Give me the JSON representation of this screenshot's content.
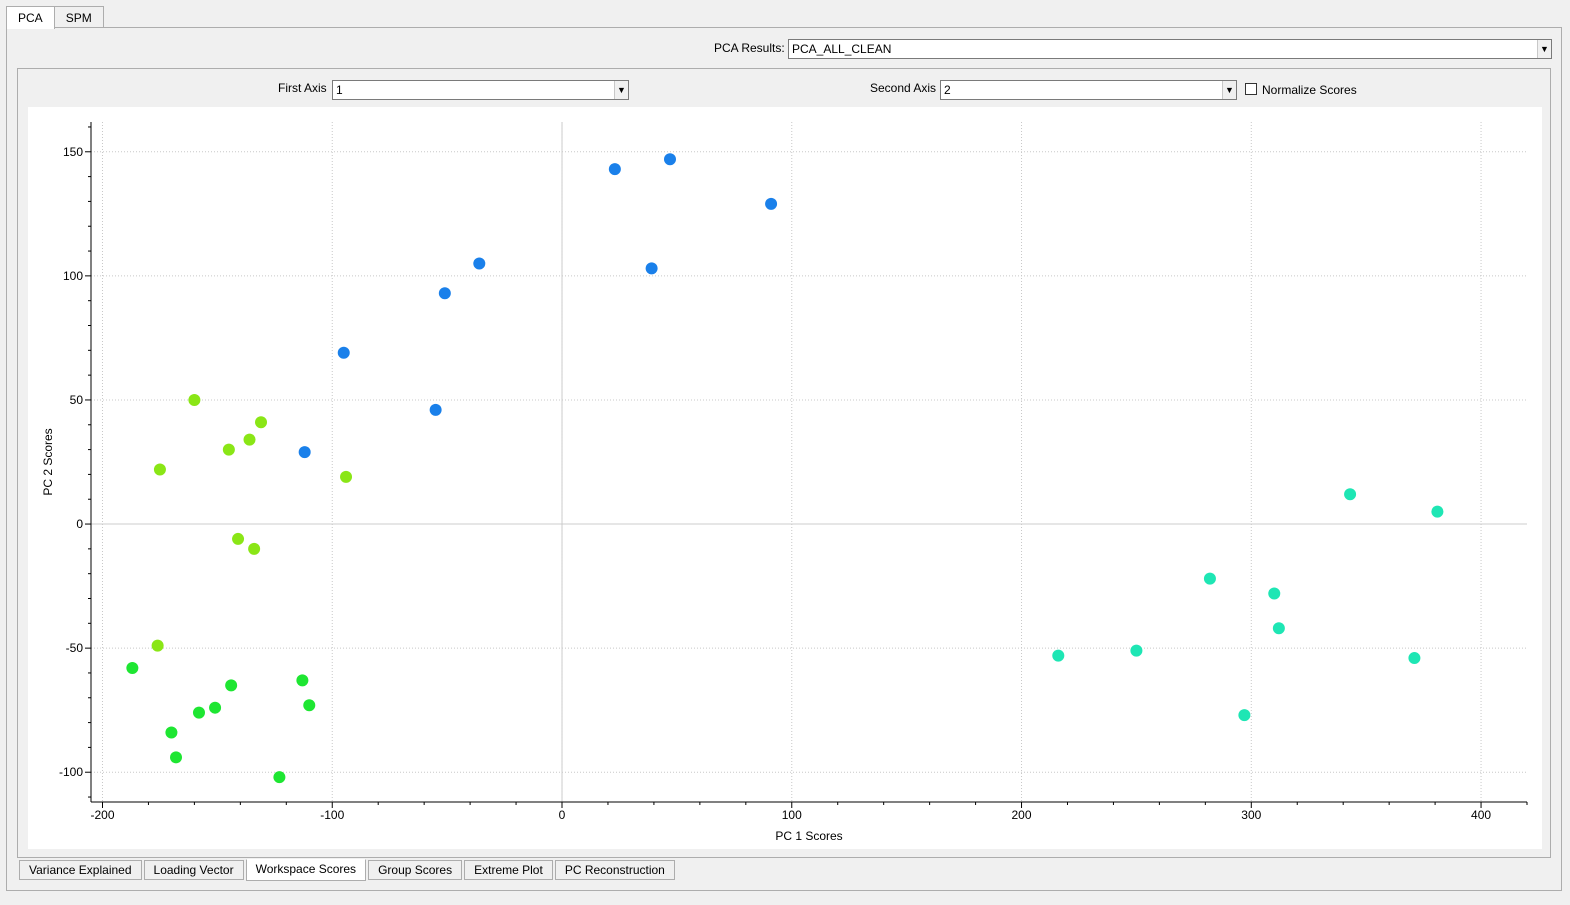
{
  "top_tabs": [
    {
      "label": "PCA",
      "active": true
    },
    {
      "label": "SPM",
      "active": false
    }
  ],
  "results": {
    "label": "PCA Results:",
    "value": "PCA_ALL_CLEAN"
  },
  "axis_controls": {
    "first_axis_label": "First Axis",
    "first_axis_value": "1",
    "second_axis_label": "Second Axis",
    "second_axis_value": "2",
    "normalize_label": "Normalize Scores",
    "normalize_checked": false
  },
  "bottom_tabs": [
    {
      "label": "Variance Explained",
      "active": false
    },
    {
      "label": "Loading Vector",
      "active": false
    },
    {
      "label": "Workspace Scores",
      "active": true
    },
    {
      "label": "Group Scores",
      "active": false
    },
    {
      "label": "Extreme Plot",
      "active": false
    },
    {
      "label": "PC Reconstruction",
      "active": false
    }
  ],
  "chart_data": {
    "type": "scatter",
    "xlabel": "PC 1 Scores",
    "ylabel": "PC 2 Scores",
    "xlim": [
      -205,
      420
    ],
    "ylim": [
      -112,
      162
    ],
    "xticks": [
      -200,
      -100,
      0,
      100,
      200,
      300,
      400
    ],
    "yticks": [
      -100,
      -50,
      0,
      50,
      100,
      150
    ],
    "grid": true,
    "series": [
      {
        "color": "#1a80ea",
        "points": [
          [
            23,
            143
          ],
          [
            47,
            147
          ],
          [
            91,
            129
          ],
          [
            39,
            103
          ],
          [
            -36,
            105
          ],
          [
            -51,
            93
          ],
          [
            -95,
            69
          ],
          [
            -55,
            46
          ],
          [
            -112,
            29
          ]
        ]
      },
      {
        "color": "#8ae616",
        "points": [
          [
            -160,
            50
          ],
          [
            -175,
            22
          ],
          [
            -145,
            30
          ],
          [
            -136,
            34
          ],
          [
            -131,
            41
          ],
          [
            -94,
            19
          ],
          [
            -141,
            -6
          ],
          [
            -134,
            -10
          ],
          [
            -176,
            -49
          ]
        ]
      },
      {
        "color": "#1ee632",
        "points": [
          [
            -187,
            -58
          ],
          [
            -170,
            -84
          ],
          [
            -168,
            -94
          ],
          [
            -158,
            -76
          ],
          [
            -151,
            -74
          ],
          [
            -144,
            -65
          ],
          [
            -113,
            -63
          ],
          [
            -110,
            -73
          ],
          [
            -123,
            -102
          ]
        ]
      },
      {
        "color": "#1ee6b4",
        "points": [
          [
            216,
            -53
          ],
          [
            250,
            -51
          ],
          [
            282,
            -22
          ],
          [
            310,
            -28
          ],
          [
            312,
            -42
          ],
          [
            297,
            -77
          ],
          [
            343,
            12
          ],
          [
            381,
            5
          ],
          [
            371,
            -54
          ]
        ]
      }
    ]
  }
}
